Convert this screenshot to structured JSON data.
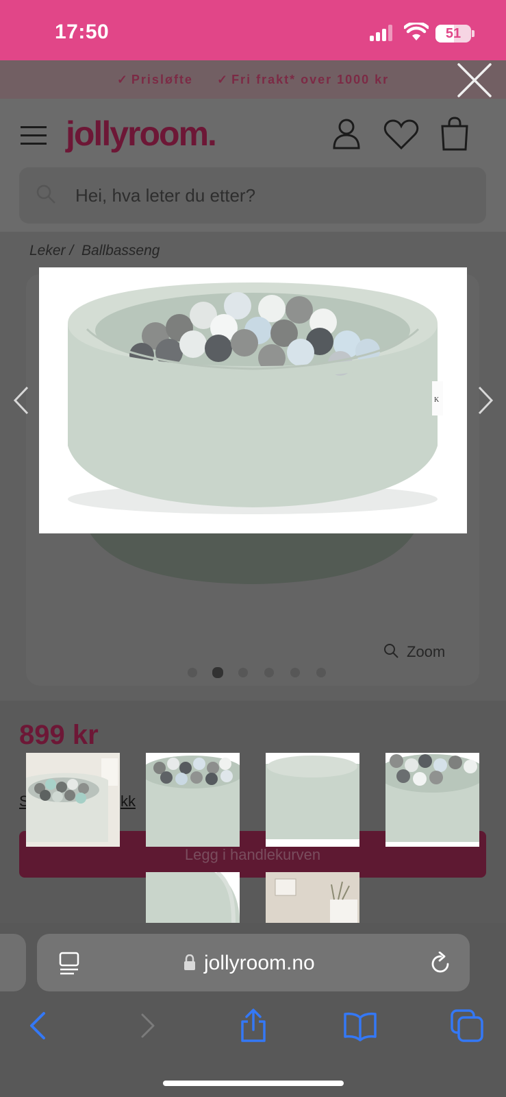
{
  "status": {
    "time": "17:50",
    "battery": "51",
    "battery_level": 0.51
  },
  "promo": {
    "items": [
      "Prisløfte",
      "Fri frakt* over 1000 kr"
    ]
  },
  "header": {
    "logo": "jollyroom.",
    "search_placeholder": "Hei, hva leter du etter?"
  },
  "breadcrumb": {
    "items": [
      "Leker /",
      "Ballbasseng"
    ]
  },
  "gallery": {
    "zoom_label": "Zoom",
    "dot_count": 6,
    "active_dot": 1
  },
  "product": {
    "price": "899 kr",
    "link_fragment_left": "S",
    "link_fragment_right": "kk",
    "add_to_cart": "Legg i handlekurven"
  },
  "browser": {
    "url": "jollyroom.no"
  },
  "colors": {
    "brand_pink": "#e14688",
    "brand_wine": "#6d1736",
    "pool_green": "#c9d5cb",
    "ios_blue": "#3478f6"
  },
  "icons": [
    "close-icon",
    "hamburger-icon",
    "user-icon",
    "heart-icon",
    "bag-icon",
    "search-icon",
    "chevron-left-icon",
    "chevron-right-icon",
    "reader-icon",
    "lock-icon",
    "reload-icon",
    "back-icon",
    "forward-icon",
    "share-icon",
    "bookmarks-icon",
    "tabs-icon"
  ]
}
